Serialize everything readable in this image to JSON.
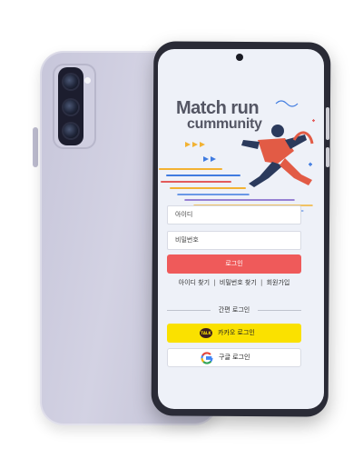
{
  "app": {
    "title_line1": "Match run",
    "title_line2": "cummunity"
  },
  "login": {
    "id_value": "아이디",
    "password_value": "비밀번호",
    "login_label": "로그인"
  },
  "links": {
    "find_id": "아이디 찾기",
    "separator": "|",
    "find_password": "비밀번호 찾기",
    "signup": "회원가입"
  },
  "social": {
    "divider_label": "간편 로그인",
    "kakao_badge": "TALK",
    "kakao_label": "카카오 로그인",
    "google_label": "구글 로그인"
  },
  "colors": {
    "login_button": "#ef5a5a",
    "kakao_button": "#fae100",
    "phone_back": "#c7c6da"
  }
}
